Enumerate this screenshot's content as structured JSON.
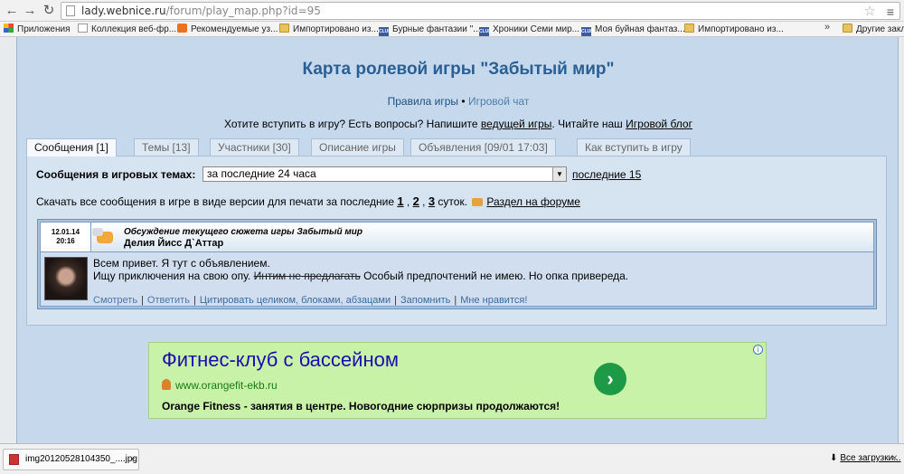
{
  "browser": {
    "url_host": "lady.webnice.ru",
    "url_path": "/forum/play_map.php?id=95",
    "bookmarks": [
      {
        "label": "Приложения",
        "icon": "apps-icon"
      },
      {
        "label": "Коллекция веб-фр...",
        "icon": "page-icon"
      },
      {
        "label": "Рекомендуемые уз...",
        "icon": "orange-icon"
      },
      {
        "label": "Импортировано из...",
        "icon": "folder-icon"
      },
      {
        "label": "Бурные фантазии \"...",
        "icon": "club-icon"
      },
      {
        "label": "Хроники Семи мир...",
        "icon": "club-icon"
      },
      {
        "label": "Моя буйная фантаз...",
        "icon": "club-icon"
      },
      {
        "label": "Импортировано из...",
        "icon": "folder-icon"
      }
    ],
    "bookmarks_more": "»",
    "other_bookmarks": "Другие закла"
  },
  "header": {
    "title": "Карта ролевой игры \"Забытый мир\"",
    "rules_link": "Правила игры",
    "bullet": "•",
    "chat_link": "Игровой чат",
    "join_text_1": "Хотите вступить в игру? Есть вопросы? Напишите ",
    "join_link_1": "ведущей игры",
    "join_text_2": ". Читайте наш ",
    "join_link_2": "Игровой блог"
  },
  "tabs": [
    {
      "label": "Сообщения [1]",
      "active": true
    },
    {
      "label": "Темы [13]",
      "active": false
    },
    {
      "label": "Участники [30]",
      "active": false
    },
    {
      "label": "Описание игры",
      "active": false
    },
    {
      "label": "Объявления [09/01 17:03]",
      "active": false
    },
    {
      "label": "Как вступить в игру",
      "active": false
    }
  ],
  "filter": {
    "label": "Сообщения в игровых темах:",
    "selected": "за последние 24 часа",
    "last_link": "последние 15"
  },
  "download": {
    "text": "Скачать все сообщения в игре в виде версии для печати за последние ",
    "d1": "1",
    "d2": "2",
    "d3": "3",
    "suffix": " суток.",
    "forum_link": "Раздел на форуме"
  },
  "post": {
    "date": "12.01.14",
    "time": "20:16",
    "topic": "Обсуждение текущего сюжета игры Забытый мир",
    "author": "Делия Йисс Д`Аттар",
    "line1": "Всем привет. Я тут с объявлением.",
    "line2_a": "Ищу приключения на свою опу. ",
    "line2_strike": "Интим не предлагать",
    "line2_b": " Особый предпочтений не имею. Но опка привереда.",
    "actions": {
      "view": "Смотреть",
      "reply": "Ответить",
      "quote_prefix": "Цитировать целиком",
      "blocks": "блоками",
      "paragraphs": "абзацами",
      "remember": "Запомнить",
      "like": "Мне нравится!"
    }
  },
  "ad": {
    "title": "Фитнес-клуб с бассейном",
    "url": "www.orangefit-ekb.ru",
    "text": "Orange Fitness - занятия в центре. Новогодние сюрпризы продолжаются!"
  },
  "downloads_bar": {
    "file": "img20120528104350_....jpg",
    "all_label": "Все загрузки..."
  }
}
